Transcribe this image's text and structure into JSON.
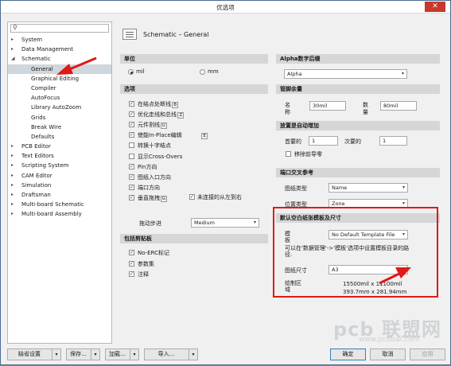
{
  "window": {
    "title": "优选项",
    "close_icon": "close-icon"
  },
  "search": {
    "placeholder": "",
    "icon": "search-icon"
  },
  "tree": [
    {
      "label": "System",
      "level": 0,
      "expanded": false
    },
    {
      "label": "Data Management",
      "level": 0,
      "expanded": false
    },
    {
      "label": "Schematic",
      "level": 0,
      "expanded": true
    },
    {
      "label": "General",
      "level": 1,
      "selected": true
    },
    {
      "label": "Graphical Editing",
      "level": 1
    },
    {
      "label": "Compiler",
      "level": 1
    },
    {
      "label": "AutoFocus",
      "level": 1
    },
    {
      "label": "Library AutoZoom",
      "level": 1
    },
    {
      "label": "Grids",
      "level": 1
    },
    {
      "label": "Break Wire",
      "level": 1
    },
    {
      "label": "Defaults",
      "level": 1
    },
    {
      "label": "PCB Editor",
      "level": 0,
      "expanded": false
    },
    {
      "label": "Text Editors",
      "level": 0,
      "expanded": false
    },
    {
      "label": "Scripting System",
      "level": 0,
      "expanded": false
    },
    {
      "label": "CAM Editor",
      "level": 0,
      "expanded": false
    },
    {
      "label": "Simulation",
      "level": 0,
      "expanded": false
    },
    {
      "label": "Draftsman",
      "level": 0,
      "expanded": false
    },
    {
      "label": "Multi-board Schematic",
      "level": 0,
      "expanded": false
    },
    {
      "label": "Multi-board Assembly",
      "level": 0,
      "expanded": false
    }
  ],
  "page": {
    "title": "Schematic – General"
  },
  "units": {
    "header": "单位",
    "mil_label": "mil",
    "mm_label": "mm",
    "selected": "mil"
  },
  "options": {
    "header": "选项",
    "items": [
      {
        "label": "在结点处断线",
        "hotkey": "B",
        "checked": true
      },
      {
        "label": "优化走线和总线",
        "hotkey": "Z",
        "checked": true
      },
      {
        "label": "元件割线",
        "hotkey": "U",
        "checked": true
      },
      {
        "label": "使能In-Place编辑",
        "hotkey": "E",
        "checked": true
      },
      {
        "label": "转换十字结点",
        "hotkey": "",
        "checked": false
      },
      {
        "label": "显示Cross-Overs",
        "hotkey": "",
        "checked": false
      },
      {
        "label": "Pin方向",
        "hotkey": "",
        "checked": true
      },
      {
        "label": "图纸入口方向",
        "hotkey": "",
        "checked": true
      },
      {
        "label": "端口方向",
        "hotkey": "",
        "checked": true
      },
      {
        "label": "垂直拖拽",
        "hotkey": "G",
        "checked": true
      }
    ],
    "unconnected_label": "未连接的从左到右",
    "unconnected_checked": true,
    "drag_step_label": "拖动步进",
    "drag_step_value": "Medium"
  },
  "clipboard": {
    "header": "包括剪贴板",
    "items": [
      {
        "label": "No-ERC标记",
        "checked": true
      },
      {
        "label": "参数集",
        "checked": true
      },
      {
        "label": "注释",
        "checked": true
      }
    ]
  },
  "alpha": {
    "header": "Alpha数字后缀",
    "value": "Alpha"
  },
  "pin_margin": {
    "header": "管脚余量",
    "name_label": "名称",
    "name_value": "30mil",
    "number_label": "数量",
    "number_value": "80mil"
  },
  "auto_increment": {
    "header": "放置是自动增加",
    "primary_label": "首要的",
    "primary_value": "1",
    "secondary_label": "次要的",
    "secondary_value": "1",
    "remove_leading_label": "移除前导零"
  },
  "port_cross_ref": {
    "header": "端口交叉参考",
    "sheet_type_label": "图纸类型",
    "sheet_type_value": "Name",
    "location_label": "位置类型",
    "location_value": "Zone"
  },
  "default_template": {
    "header": "默认空白纸张模板及尺寸",
    "template_label": "模板",
    "template_value": "No Default Template File",
    "hint": "可以在'数据管理'->'模板'选项中设置模板目录的路径.",
    "sheet_size_label": "图纸尺寸",
    "sheet_size_value": "A3",
    "drawing_area_label": "绘制区域",
    "drawing_area_mil": "15500mil x 11100mil",
    "drawing_area_mm": "393.7mm x 281.94mm"
  },
  "buttons": {
    "default_settings": "缺省设置",
    "save": "保存...",
    "load": "加载...",
    "import": "导入...",
    "ok": "确定",
    "cancel": "取消",
    "apply": "应用"
  },
  "watermark": {
    "text": "pcb 联盟网",
    "url": "www.pcbbar.com"
  },
  "colors": {
    "highlight": "#e01818",
    "section_bg": "#d6d6d6",
    "selected_bg": "#cfd6dc"
  }
}
